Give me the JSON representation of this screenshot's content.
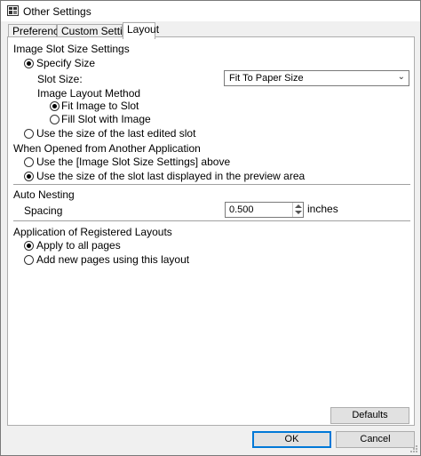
{
  "window": {
    "title": "Other Settings",
    "icon": "app-icon"
  },
  "tabs": [
    {
      "label": "Preferences",
      "active": false
    },
    {
      "label": "Custom Settings",
      "active": false
    },
    {
      "label": "Layout",
      "active": true
    }
  ],
  "image_slot": {
    "heading": "Image Slot Size Settings",
    "specify_size": {
      "label": "Specify Size",
      "checked": true
    },
    "slot_size": {
      "label": "Slot Size:",
      "value": "Fit To Paper Size"
    },
    "layout_method": {
      "label": "Image Layout Method",
      "fit_image": {
        "label": "Fit Image to Slot",
        "checked": true
      },
      "fill_slot": {
        "label": "Fill Slot with Image",
        "checked": false
      }
    },
    "last_edited": {
      "label": "Use the size of the last edited slot",
      "checked": false
    }
  },
  "when_opened": {
    "heading": "When Opened from Another Application",
    "use_above": {
      "label": "Use the [Image Slot Size Settings] above",
      "checked": false
    },
    "use_preview": {
      "label": "Use the size of the slot last displayed in the preview area",
      "checked": true
    }
  },
  "auto_nesting": {
    "heading": "Auto Nesting",
    "spacing_label": "Spacing",
    "spacing_value": "0.500",
    "unit": "inches"
  },
  "registered_layouts": {
    "heading": "Application of Registered Layouts",
    "apply_all": {
      "label": "Apply to all pages",
      "checked": true
    },
    "add_new": {
      "label": "Add new pages using this layout",
      "checked": false
    }
  },
  "buttons": {
    "defaults": "Defaults",
    "ok": "OK",
    "cancel": "Cancel"
  }
}
